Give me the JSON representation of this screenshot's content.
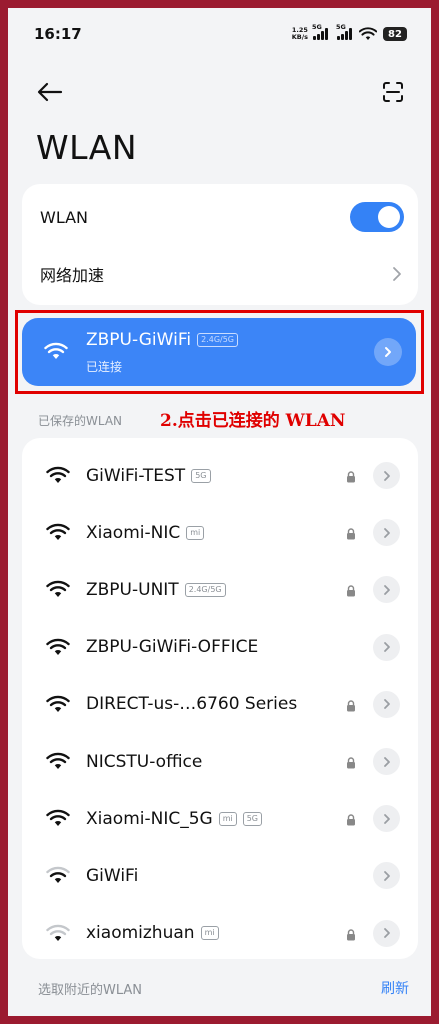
{
  "status_bar": {
    "time": "16:17",
    "net_speed_value": "1.25",
    "net_speed_unit": "KB/s",
    "sim1_tag": "5G",
    "sim2_tag": "5G",
    "battery": "82"
  },
  "header": {
    "back_icon": "arrow-left-icon",
    "scan_icon": "scan-icon",
    "title": "WLAN"
  },
  "settings": {
    "wlan_label": "WLAN",
    "wlan_enabled": true,
    "accelerate_label": "网络加速"
  },
  "connected": {
    "name": "ZBPU-GiWiFi",
    "band": "2.4G/5G",
    "status": "已连接"
  },
  "saved_header": "已保存的WLAN",
  "annotation": "2.点击已连接的 WLAN",
  "saved_networks": [
    {
      "name": "GiWiFi-TEST",
      "tags": [
        "5G"
      ],
      "locked": true,
      "signal": "full"
    },
    {
      "name": "Xiaomi-NIC",
      "tags": [
        "mi"
      ],
      "locked": true,
      "signal": "full"
    },
    {
      "name": "ZBPU-UNIT",
      "tags": [
        "2.4G/5G"
      ],
      "locked": true,
      "signal": "full"
    },
    {
      "name": "ZBPU-GiWiFi-OFFICE",
      "tags": [],
      "locked": false,
      "signal": "full"
    },
    {
      "name": "DIRECT-us-…6760 Series",
      "tags": [],
      "locked": true,
      "signal": "full"
    },
    {
      "name": "NICSTU-office",
      "tags": [],
      "locked": true,
      "signal": "full"
    },
    {
      "name": "Xiaomi-NIC_5G",
      "tags": [
        "mi",
        "5G"
      ],
      "locked": true,
      "signal": "full"
    },
    {
      "name": "GiWiFi",
      "tags": [],
      "locked": false,
      "signal": "medium"
    },
    {
      "name": "xiaomizhuan",
      "tags": [
        "mi"
      ],
      "locked": true,
      "signal": "low"
    }
  ],
  "footer": {
    "nearby_label": "选取附近的WLAN",
    "refresh_label": "刷新"
  },
  "colors": {
    "accent": "#3482f6",
    "connected_bg": "#3c85f7",
    "highlight": "#e00000",
    "frame": "#9b1b30"
  }
}
